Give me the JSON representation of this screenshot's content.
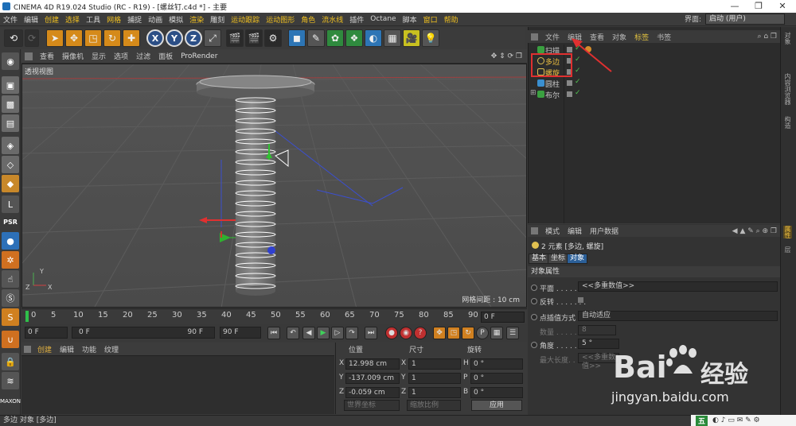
{
  "window": {
    "title": "CINEMA 4D R19.024 Studio (RC - R19) - [螺丝钉.c4d *] - 主要",
    "minimize": "—",
    "maximize": "❐",
    "close": "✕"
  },
  "menubar": [
    "文件",
    "编辑",
    "创建",
    "选择",
    "工具",
    "网格",
    "捕捉",
    "动画",
    "模拟",
    "渲染",
    "雕刻",
    "运动跟踪",
    "运动图形",
    "角色",
    "流水线",
    "插件",
    "Octane",
    "脚本",
    "窗口",
    "帮助"
  ],
  "layout": {
    "label": "界面:",
    "value": "启动 (用户)"
  },
  "toolbar": {
    "undo_icon": "undo-icon",
    "x": "X",
    "y": "Y",
    "z": "Z"
  },
  "viewport_menu": [
    "查看",
    "摄像机",
    "显示",
    "选项",
    "过滤",
    "面板",
    "ProRender"
  ],
  "viewport": {
    "label": "透视视图",
    "grid": "网格间距 : 10 cm",
    "axis_x": "X",
    "axis_y": "Y",
    "axis_z": "Z"
  },
  "timeline": {
    "ticks": [
      "0",
      "5",
      "10",
      "15",
      "20",
      "25",
      "30",
      "35",
      "40",
      "45",
      "50",
      "55",
      "60",
      "65",
      "70",
      "75",
      "80",
      "85",
      "90"
    ],
    "current_frame": "0 F"
  },
  "transport": {
    "start": "0 F",
    "range_start": "0 F",
    "range_end": "90 F",
    "end": "90 F"
  },
  "material_menu": [
    "创建",
    "编辑",
    "功能",
    "纹理"
  ],
  "coordinates": {
    "headers": {
      "position": "位置",
      "size": "尺寸",
      "rotation": "旋转"
    },
    "rows": [
      {
        "axis": "X",
        "pos": "12.998 cm",
        "size_axis": "X",
        "size": "1",
        "rot_axis": "H",
        "rot": "0 °"
      },
      {
        "axis": "Y",
        "pos": "-137.009 cm",
        "size_axis": "Y",
        "size": "1",
        "rot_axis": "P",
        "rot": "0 °"
      },
      {
        "axis": "Z",
        "pos": "-0.059 cm",
        "size_axis": "Z",
        "size": "1",
        "rot_axis": "B",
        "rot": "0 °"
      }
    ],
    "mode1": "世界坐标",
    "mode2": "缩放比例",
    "apply": "应用"
  },
  "status": "多边 对象 [多边]",
  "object_menu": [
    "文件",
    "编辑",
    "查看",
    "对象",
    "标签",
    "书签"
  ],
  "objects": [
    {
      "name": "扫描",
      "color": "#3aa040",
      "selected": false
    },
    {
      "name": "多边",
      "color": "#e0c050",
      "selected": true
    },
    {
      "name": "螺旋",
      "color": "#e0c050",
      "selected": true
    },
    {
      "name": "圆柱",
      "color": "#3a8fd0",
      "selected": false
    },
    {
      "name": "布尔",
      "color": "#3aa040",
      "selected": false
    }
  ],
  "attributes": {
    "menu": [
      "模式",
      "编辑",
      "用户数据"
    ],
    "selection": "2 元素 [多边, 螺旋]",
    "tabs": [
      "基本",
      "坐标",
      "对象"
    ],
    "section": "对象属性",
    "rows": [
      {
        "label": "平面 . . . . . . .",
        "value": "<<多重数值>>"
      },
      {
        "label": "反转 . . . . . . ."
      },
      {
        "label": "点插值方式",
        "value": "自动适应"
      },
      {
        "label": "数量 . . . . . . .",
        "value": "8"
      },
      {
        "label": "角度 . . . . . . .",
        "value": "5 °"
      },
      {
        "label": "最大长度. . . . .",
        "value": "<<多重数值>>"
      }
    ]
  },
  "right_tabs": [
    "对象",
    "内容浏览器",
    "构造",
    "层",
    "属性"
  ],
  "watermark": {
    "bai": "Bai",
    "du": "经验",
    "url": "jingyan.baidu.com"
  },
  "tray": {
    "ime": "五",
    "icons": "◐ ♪ ▭ ✉ ✎ ⚙"
  }
}
